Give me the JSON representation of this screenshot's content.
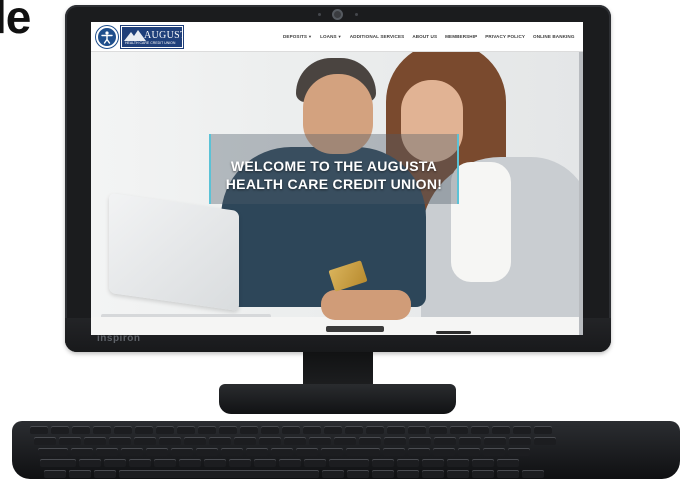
{
  "cropped_heading": "le",
  "device": {
    "brand": "inspiron"
  },
  "site": {
    "logo_text": "AUGUSTA",
    "logo_subtext": "HEALTH CARE CREDIT UNION",
    "nav": [
      {
        "label": "DEPOSITS",
        "dropdown": true
      },
      {
        "label": "LOANS",
        "dropdown": true
      },
      {
        "label": "ADDITIONAL SERVICES",
        "dropdown": false
      },
      {
        "label": "ABOUT US",
        "dropdown": false
      },
      {
        "label": "MEMBERSHIP",
        "dropdown": false
      },
      {
        "label": "PRIVACY POLICY",
        "dropdown": false
      },
      {
        "label": "ONLINE BANKING",
        "dropdown": false
      }
    ],
    "hero_title": "WELCOME TO THE AUGUSTA HEALTH CARE CREDIT UNION!"
  },
  "icons": {
    "accessibility": "accessibility-icon",
    "dropdown": "chevron-down-icon"
  },
  "colors": {
    "brand_navy": "#1f3f7a",
    "accent_teal": "#5bc2d6"
  }
}
